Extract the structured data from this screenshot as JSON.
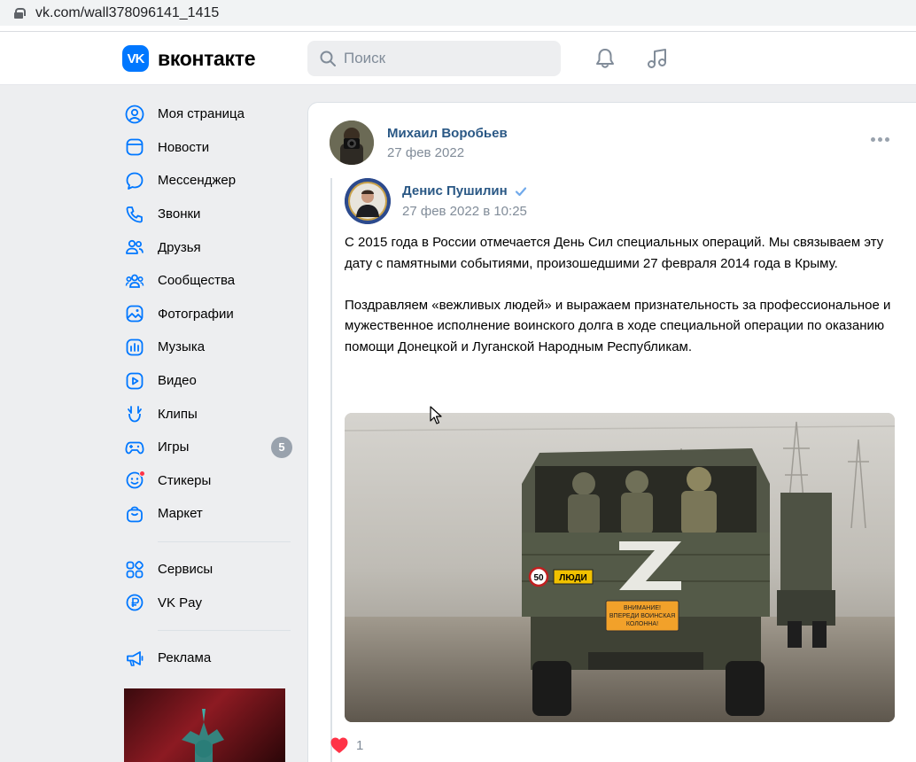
{
  "browser": {
    "url": "vk.com/wall378096141_1415"
  },
  "header": {
    "logo_text": "вконтакте",
    "logo_mark": "VK",
    "search_placeholder": "Поиск",
    "accent": "#0077ff"
  },
  "sidebar": {
    "items": [
      {
        "label": "Моя страница",
        "icon": "user-circle-icon"
      },
      {
        "label": "Новости",
        "icon": "news-icon"
      },
      {
        "label": "Мессенджер",
        "icon": "message-icon"
      },
      {
        "label": "Звонки",
        "icon": "phone-icon"
      },
      {
        "label": "Друзья",
        "icon": "friends-icon"
      },
      {
        "label": "Сообщества",
        "icon": "communities-icon"
      },
      {
        "label": "Фотографии",
        "icon": "photos-icon"
      },
      {
        "label": "Музыка",
        "icon": "music-podcast-icon"
      },
      {
        "label": "Видео",
        "icon": "video-icon"
      },
      {
        "label": "Клипы",
        "icon": "clips-icon"
      },
      {
        "label": "Игры",
        "icon": "games-icon",
        "badge": "5"
      },
      {
        "label": "Стикеры",
        "icon": "stickers-icon"
      },
      {
        "label": "Маркет",
        "icon": "market-icon"
      }
    ],
    "items2": [
      {
        "label": "Сервисы",
        "icon": "services-icon"
      },
      {
        "label": "VK Pay",
        "icon": "vkpay-icon"
      }
    ],
    "items3": [
      {
        "label": "Реклама",
        "icon": "megaphone-icon"
      }
    ]
  },
  "post": {
    "author": "Михаил Воробьев",
    "date": "27 фев 2022",
    "repost": {
      "author": "Денис Пушилин",
      "date": "27 фев 2022 в 10:25",
      "paragraph1": "С 2015 года в России отмечается День Сил специальных операций. Мы связываем эту дату с памятными событиями, произошедшими 27 февраля 2014 года в Крыму.",
      "paragraph2": "Поздравляем «вежливых людей» и выражаем признательность за профессиональное и мужественное исполнение воинского долга в ходе специальной операции по оказанию помощи Донецкой и Луганской Народным Республикам."
    },
    "photo": {
      "plate_speed": "50",
      "plate_people": "ЛЮДИ",
      "sign_line1": "ВНИМАНИЕ!",
      "sign_line2": "ВПЕРЕДИ ВОИНСКАЯ",
      "sign_line3": "КОЛОННА!"
    },
    "likes": "1"
  }
}
